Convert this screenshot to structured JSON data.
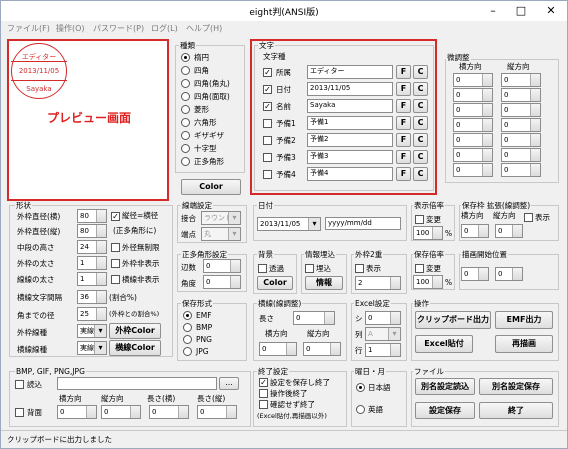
{
  "window": {
    "title": "eight判(ANSI版)",
    "min": "–",
    "max": "□",
    "close": "✕"
  },
  "menu": [
    "ファイル(F)",
    "操作(O)",
    "パスワード(P)",
    "ログ(L)",
    "ヘルプ(H)"
  ],
  "preview": {
    "stamp_lines": [
      "エディター",
      "2013/11/05",
      "Sayaka"
    ],
    "label": "プレビュー画面"
  },
  "kind": {
    "title": "種類",
    "options": [
      "楕円",
      "四角",
      "四角(角丸)",
      "四角(面取)",
      "菱形",
      "六角形",
      "ギザギザ",
      "十字型",
      "正多角形"
    ],
    "selected": 0,
    "color_button": "Color"
  },
  "text": {
    "title": "文字",
    "subtitle": "文字種",
    "rows": [
      {
        "label": "所属",
        "checked": true,
        "value": "エディター"
      },
      {
        "label": "日付",
        "checked": true,
        "value": "2013/11/05"
      },
      {
        "label": "名前",
        "checked": true,
        "value": "Sayaka"
      },
      {
        "label": "予備1",
        "checked": false,
        "value": "予備1"
      },
      {
        "label": "予備2",
        "checked": false,
        "value": "予備2"
      },
      {
        "label": "予備3",
        "checked": false,
        "value": "予備3"
      },
      {
        "label": "予備4",
        "checked": false,
        "value": "予備4"
      }
    ],
    "f": "F",
    "c": "C"
  },
  "fine": {
    "title": "微調整",
    "col1": "横方向",
    "col2": "縦方向",
    "values": [
      "0",
      "0",
      "0",
      "0",
      "0",
      "0",
      "0",
      "0",
      "0",
      "0",
      "0",
      "0",
      "0",
      "0"
    ]
  },
  "shape": {
    "title": "形状",
    "outer_w": {
      "label": "外枠直径(横)",
      "value": "80"
    },
    "outer_h": {
      "label": "外枠直径(縦)",
      "value": "80"
    },
    "same_label": "縦径=横径",
    "same_sub": "(正多角形に)",
    "middle": {
      "label": "中段の高さ",
      "value": "24"
    },
    "outer_line": {
      "label": "外枠の太さ",
      "value": "1"
    },
    "line_w": {
      "label": "線線の太さ",
      "value": "1"
    },
    "char_gap": {
      "label": "横線文字間隔",
      "value": "36",
      "unit": "(割合%)"
    },
    "corner": {
      "label": "角までの径",
      "value": "25",
      "unit": "(外枠との割合%)"
    },
    "hide1": "外径無制限",
    "hide2": "外枠非表示",
    "hide3": "横線非表示",
    "outer_style": {
      "label": "外枠線種",
      "value": "実線"
    },
    "cross_style": {
      "label": "横線線種",
      "value": "実線"
    },
    "outer_color": "外枠Color",
    "cross_color": "横線Color"
  },
  "edge": {
    "title": "線端設定",
    "join": "接合",
    "join_val": "ラウンド",
    "end": "端点",
    "end_val": "丸"
  },
  "date": {
    "title": "日付",
    "value": "2013/11/05",
    "format": "yyyy/mm/dd"
  },
  "poly": {
    "title": "正多角形設定",
    "sides": "辺数",
    "sides_val": "0",
    "angle": "角度",
    "angle_val": "0"
  },
  "bg": {
    "title": "背景",
    "transparent": "透過",
    "color": "Color"
  },
  "info": {
    "title": "情報埋込",
    "embed": "埋込",
    "button": "情報"
  },
  "double": {
    "title": "外枠2重",
    "show": "表示",
    "value": "2"
  },
  "save": {
    "title": "保存形式",
    "options": [
      "EMF",
      "BMP",
      "PNG",
      "JPG"
    ],
    "selected": 0
  },
  "cross": {
    "title": "横線(線調整)",
    "len": "長さ",
    "len_val": "0",
    "h": "横方向",
    "v": "縦方向",
    "h_val": "0",
    "v_val": "0"
  },
  "excel": {
    "title": "Excel設定",
    "sheet": "シ",
    "col": "列",
    "row": "行",
    "sheet_val": "0",
    "col_val": "A",
    "row_val": "1"
  },
  "disp": {
    "title": "表示倍率",
    "change": "変更",
    "value": "100",
    "unit": "%"
  },
  "savediff": {
    "title": "保存倍率",
    "change": "変更",
    "value": "100",
    "unit": "%"
  },
  "exp": {
    "title": "保存枠 拡張(線調整)",
    "h": "横方向",
    "v": "縦方向",
    "show": "表示",
    "h_val": "0",
    "v_val": "0"
  },
  "drawpos": {
    "title": "描画開始位置",
    "h_val": "0",
    "v_val": "0"
  },
  "ops": {
    "title": "操作",
    "clip": "クリップボード出力",
    "emf": "EMF出力",
    "xls": "Excel貼付",
    "redraw": "再描画"
  },
  "img": {
    "title": "BMP, GIF, PNG,JPG",
    "read": "読込",
    "browse": "...",
    "back": "背面",
    "h": "横方向",
    "v": "縦方向",
    "lenh": "長さ(横)",
    "lenv": "長さ(縦)",
    "vals": [
      "0",
      "0",
      "0",
      "0"
    ]
  },
  "endset": {
    "title": "終了設定",
    "opt1": "設定を保存し終了",
    "opt2": "操作後終了",
    "opt3": "確認せず終了",
    "note": "(Excel貼付,再描画以外)"
  },
  "dow": {
    "title": "曜日・月",
    "ja": "日本語",
    "en": "英語"
  },
  "file": {
    "title": "ファイル",
    "load": "別名設定読込",
    "saveas": "別名設定保存",
    "save": "設定保存",
    "quit": "終了"
  },
  "status": "クリップボードに出力しました"
}
